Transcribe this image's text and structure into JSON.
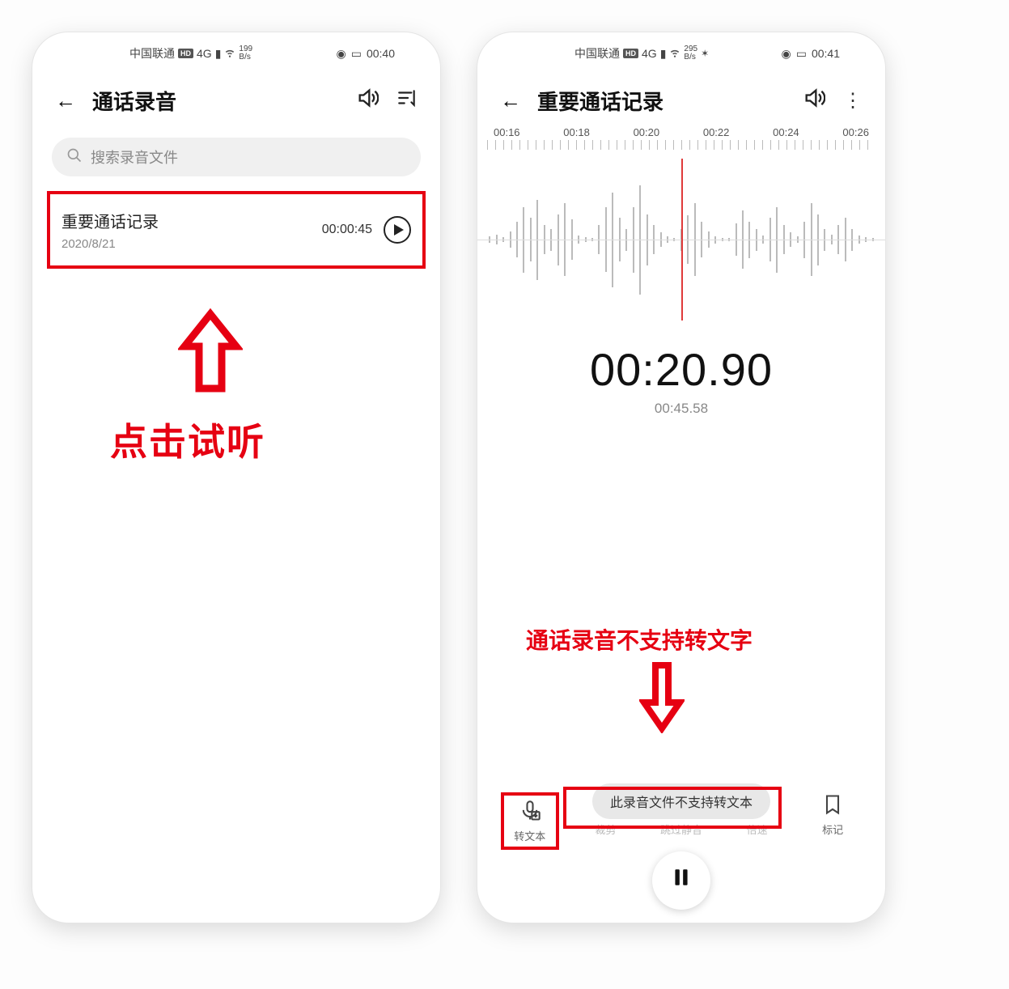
{
  "left": {
    "status": {
      "carrier": "中国联通",
      "hd": "HD",
      "net": "4G",
      "rate": "199",
      "rate_unit": "B/s",
      "time": "00:40"
    },
    "title": "通话录音",
    "search_placeholder": "搜索录音文件",
    "record": {
      "name": "重要通话记录",
      "date": "2020/8/21",
      "duration": "00:00:45"
    },
    "annotation": "点击试听"
  },
  "right": {
    "status": {
      "carrier": "中国联通",
      "hd": "HD",
      "net": "4G",
      "rate": "295",
      "rate_unit": "B/s",
      "time": "00:41"
    },
    "title": "重要通话记录",
    "timeline": [
      "00:16",
      "00:18",
      "00:20",
      "00:22",
      "00:24",
      "00:26"
    ],
    "current_time": "00:20.90",
    "total_time": "00:45.58",
    "annotation": "通话录音不支持转文字",
    "toast": "此录音文件不支持转文本",
    "toolbar": {
      "to_text": "转文本",
      "trim": "裁剪",
      "skip_silence": "跳过静音",
      "speed": "倍速",
      "mark": "标记"
    }
  }
}
